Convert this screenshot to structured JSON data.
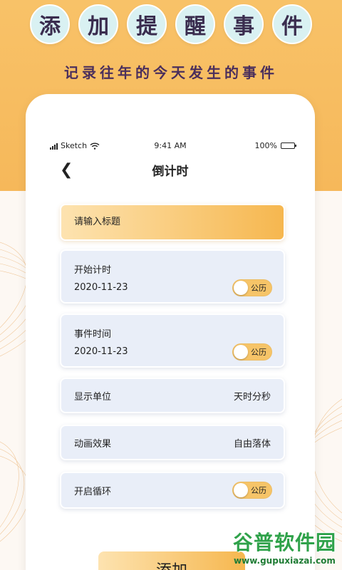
{
  "header": {
    "title_chars": [
      "添",
      "加",
      "提",
      "醒",
      "事",
      "件"
    ],
    "subtitle": "记录往年的今天发生的事件"
  },
  "status_bar": {
    "carrier": "Sketch",
    "time": "9:41 AM",
    "battery": "100%"
  },
  "nav": {
    "back_icon": "chevron-left-icon",
    "title": "倒计时"
  },
  "form": {
    "title_placeholder": "请输入标题",
    "start": {
      "label": "开始计时",
      "date": "2020-11-23",
      "toggle_label": "公历"
    },
    "event": {
      "label": "事件时间",
      "date": "2020-11-23",
      "toggle_label": "公历"
    },
    "unit": {
      "label": "显示单位",
      "value": "天时分秒"
    },
    "animation": {
      "label": "动画效果",
      "value": "自由落体"
    },
    "loop": {
      "label": "开启循环",
      "toggle_label": "公历"
    }
  },
  "actions": {
    "add_label": "添加"
  },
  "watermark": {
    "name": "谷普软件园",
    "url": "www.gupuxiazai.com"
  },
  "colors": {
    "accent": "#f6b85a",
    "circle_bg": "#d9f1f2",
    "card_bg": "#e9eef8",
    "text_dark": "#3a2d4f"
  }
}
